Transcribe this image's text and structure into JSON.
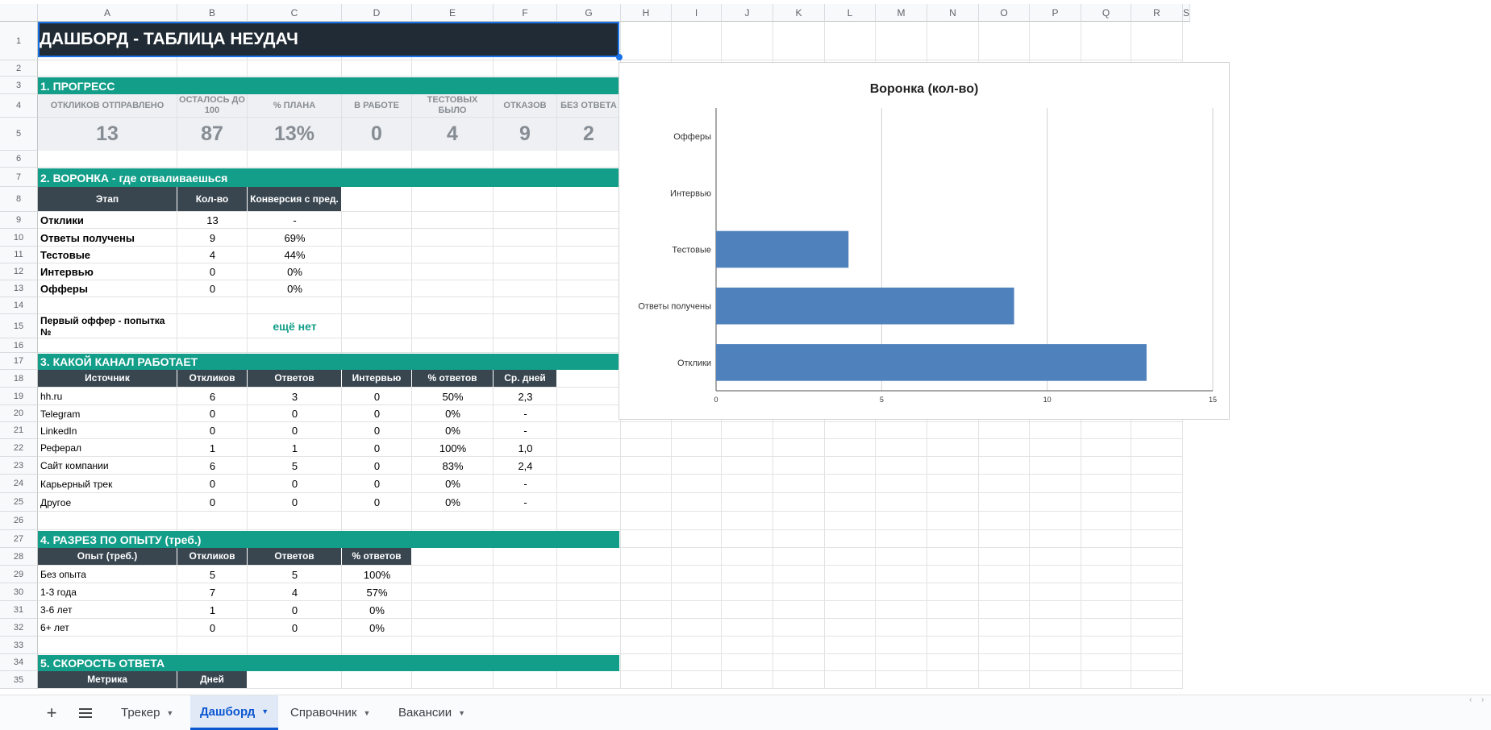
{
  "columns": [
    "A",
    "B",
    "C",
    "D",
    "E",
    "F",
    "G",
    "H",
    "I",
    "J",
    "K",
    "L",
    "M",
    "N",
    "O",
    "P",
    "Q",
    "R",
    "S"
  ],
  "rows": [
    "1",
    "2",
    "3",
    "4",
    "5",
    "6",
    "7",
    "8",
    "9",
    "10",
    "11",
    "12",
    "13",
    "14",
    "15",
    "16",
    "17",
    "18",
    "19",
    "20",
    "21",
    "22",
    "23",
    "24",
    "25",
    "26",
    "27",
    "28",
    "29",
    "30",
    "31",
    "32",
    "33",
    "34",
    "35"
  ],
  "title": "ДАШБОРД - ТАБЛИЦА НЕУДАЧ",
  "progress": {
    "header": "1. ПРОГРЕСС",
    "labels": [
      "ОТКЛИКОВ ОТПРАВЛЕНО",
      "ОСТАЛОСЬ ДО 100",
      "% ПЛАНА",
      "В РАБОТЕ",
      "ТЕСТОВЫХ БЫЛО",
      "ОТКАЗОВ",
      "БЕЗ ОТВЕТА"
    ],
    "values": [
      "13",
      "87",
      "13%",
      "0",
      "4",
      "9",
      "2"
    ]
  },
  "funnel": {
    "header": "2. ВОРОНКА - где отваливаешься",
    "columns": [
      "Этап",
      "Кол-во",
      "Конверсия с пред."
    ],
    "rows": [
      [
        "Отклики",
        "13",
        "-"
      ],
      [
        "Ответы получены",
        "9",
        "69%"
      ],
      [
        "Тестовые",
        "4",
        "44%"
      ],
      [
        "Интервью",
        "0",
        "0%"
      ],
      [
        "Офферы",
        "0",
        "0%"
      ]
    ],
    "first_offer_label": "Первый оффер - попытка №",
    "first_offer_value": "ещё нет"
  },
  "channels": {
    "header": "3. КАКОЙ КАНАЛ РАБОТАЕТ",
    "columns": [
      "Источник",
      "Откликов",
      "Ответов",
      "Интервью",
      "% ответов",
      "Ср. дней"
    ],
    "rows": [
      [
        "hh.ru",
        "6",
        "3",
        "0",
        "50%",
        "2,3"
      ],
      [
        "Telegram",
        "0",
        "0",
        "0",
        "0%",
        "-"
      ],
      [
        "LinkedIn",
        "0",
        "0",
        "0",
        "0%",
        "-"
      ],
      [
        "Реферал",
        "1",
        "1",
        "0",
        "100%",
        "1,0"
      ],
      [
        "Сайт компании",
        "6",
        "5",
        "0",
        "83%",
        "2,4"
      ],
      [
        "Карьерный трек",
        "0",
        "0",
        "0",
        "0%",
        "-"
      ],
      [
        "Другое",
        "0",
        "0",
        "0",
        "0%",
        "-"
      ]
    ]
  },
  "experience": {
    "header": "4. РАЗРЕЗ ПО ОПЫТУ (треб.)",
    "columns": [
      "Опыт (треб.)",
      "Откликов",
      "Ответов",
      "% ответов"
    ],
    "rows": [
      [
        "Без опыта",
        "5",
        "5",
        "100%"
      ],
      [
        "1-3 года",
        "7",
        "4",
        "57%"
      ],
      [
        "3-6 лет",
        "1",
        "0",
        "0%"
      ],
      [
        "6+ лет",
        "0",
        "0",
        "0%"
      ]
    ]
  },
  "speed": {
    "header": "5. СКОРОСТЬ ОТВЕТА",
    "columns": [
      "Метрика",
      "Дней"
    ]
  },
  "chart_data": {
    "type": "bar",
    "orientation": "horizontal",
    "title": "Воронка (кол-во)",
    "categories": [
      "Офферы",
      "Интервью",
      "Тестовые",
      "Ответы получены",
      "Отклики"
    ],
    "values": [
      0,
      0,
      4,
      9,
      13
    ],
    "xlim": [
      0,
      15
    ],
    "xticks": [
      "0",
      "5",
      "10",
      "15"
    ],
    "xlabel": "",
    "ylabel": "",
    "grid": true,
    "bar_color": "#4f81bd"
  },
  "sheet_tabs": [
    {
      "label": "Трекер",
      "active": false
    },
    {
      "label": "Дашборд",
      "active": true
    },
    {
      "label": "Справочник",
      "active": false
    },
    {
      "label": "Вакансии",
      "active": false
    }
  ],
  "icons": {
    "add_sheet": "plus-icon",
    "all_sheets": "menu-icon"
  }
}
